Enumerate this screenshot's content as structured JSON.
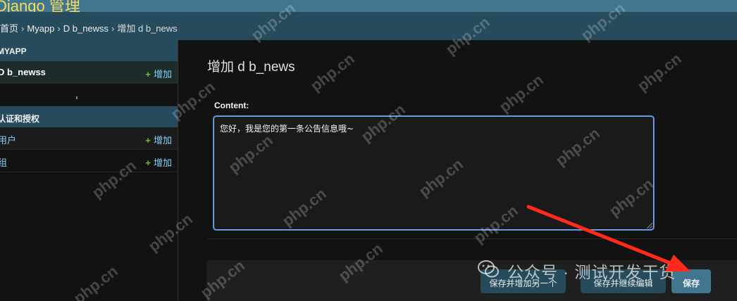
{
  "header": {
    "site_name": "Django 管理"
  },
  "breadcrumbs": {
    "home": "首页",
    "app": "Myapp",
    "model": "D b_newss",
    "current": "增加 d b_news",
    "separator": "›"
  },
  "sidebar": {
    "modules": [
      {
        "caption": "MYAPP",
        "models": [
          {
            "name": "D b_newss",
            "add_label": "增加",
            "selected": true
          }
        ]
      },
      {
        "caption": "认证和授权",
        "models": [
          {
            "name": "用户",
            "add_label": "增加"
          },
          {
            "name": "组",
            "add_label": "增加"
          }
        ]
      }
    ],
    "add_icon": "+"
  },
  "main": {
    "title": "增加 d b_news",
    "field_label": "Content:",
    "field_value": "您好，我是您的第一条公告信息哦~",
    "buttons": {
      "save_and_add_another": "保存并增加另一个",
      "save_and_continue": "保存并继续编辑",
      "save": "保存"
    }
  },
  "overlay": {
    "watermark_text": "php.cn",
    "wechat_text": "公众号 · 测试开发干货",
    "arrow_color": "#ff2a1a"
  }
}
